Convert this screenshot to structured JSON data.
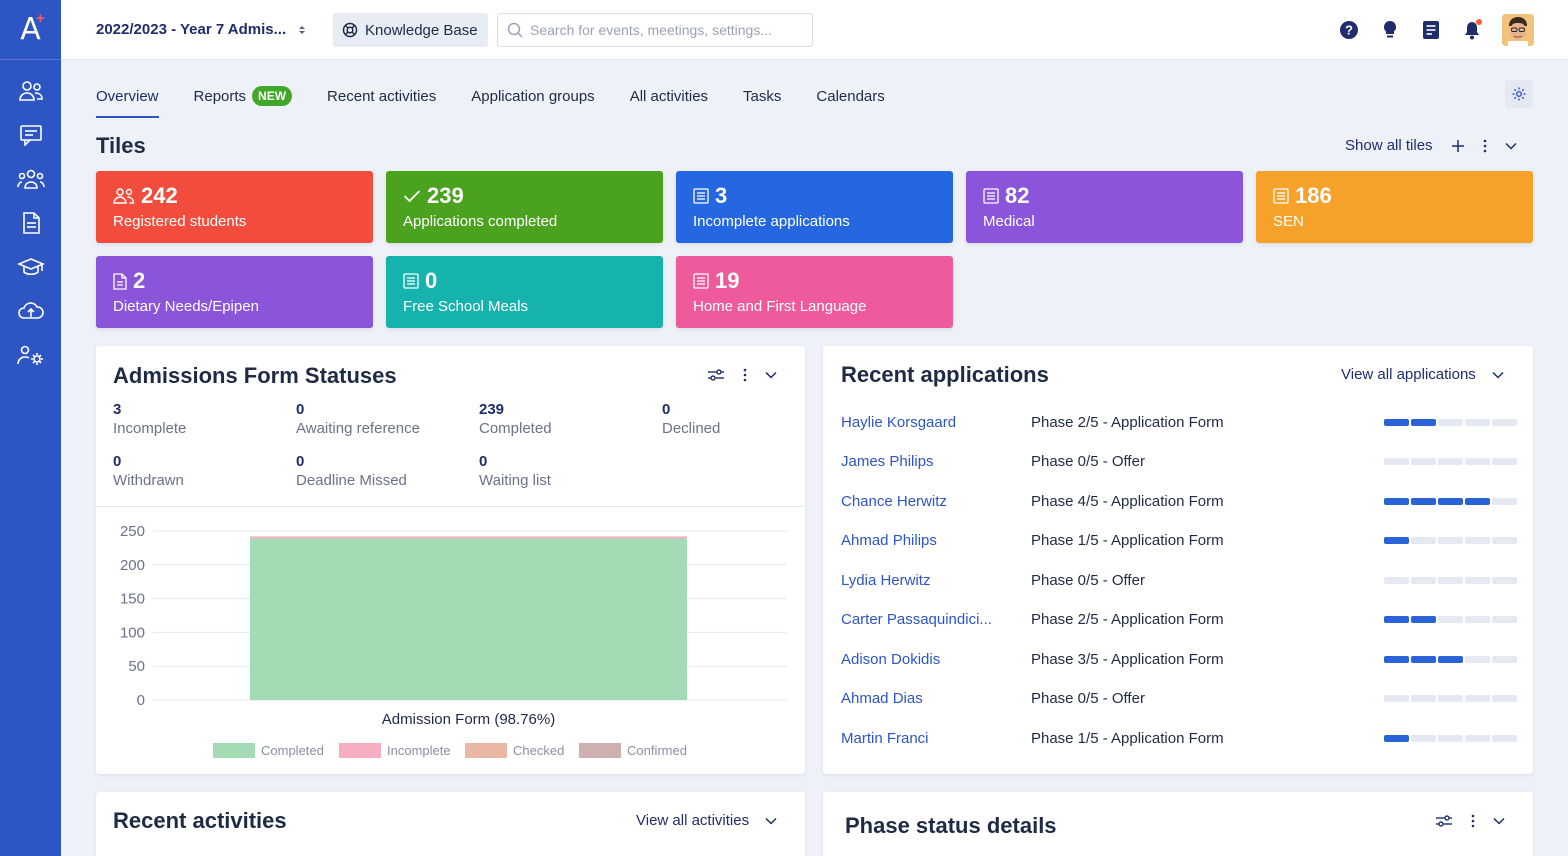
{
  "topbar": {
    "year_selector": "2022/2023 - Year 7 Admis...",
    "knowledge_base": "Knowledge Base",
    "search_placeholder": "Search for events, meetings, settings..."
  },
  "tabs": [
    {
      "label": "Overview",
      "active": true
    },
    {
      "label": "Reports",
      "badge": "NEW"
    },
    {
      "label": "Recent activities"
    },
    {
      "label": "Application groups"
    },
    {
      "label": "All activities"
    },
    {
      "label": "Tasks"
    },
    {
      "label": "Calendars"
    }
  ],
  "tiles": {
    "title": "Tiles",
    "show_all": "Show all tiles",
    "items": [
      {
        "number": "242",
        "label": "Registered students",
        "color": "#f24c3d",
        "icon": "users-icon"
      },
      {
        "number": "239",
        "label": "Applications completed",
        "color": "#4aa21f",
        "icon": "check-icon"
      },
      {
        "number": "3",
        "label": "Incomplete applications",
        "color": "#2467e0",
        "icon": "list-icon"
      },
      {
        "number": "82",
        "label": "Medical",
        "color": "#8a55db",
        "icon": "list-icon"
      },
      {
        "number": "186",
        "label": "SEN",
        "color": "#f5a12a",
        "icon": "list-icon"
      },
      {
        "number": "2",
        "label": "Dietary Needs/Epipen",
        "color": "#8a55db",
        "icon": "document-icon"
      },
      {
        "number": "0",
        "label": "Free School Meals",
        "color": "#16b2ae",
        "icon": "list-icon"
      },
      {
        "number": "19",
        "label": "Home and First Language",
        "color": "#ef5a9c",
        "icon": "list-icon"
      }
    ]
  },
  "admissions": {
    "title": "Admissions Form Statuses",
    "stats": [
      {
        "value": "3",
        "label": "Incomplete"
      },
      {
        "value": "0",
        "label": "Awaiting reference"
      },
      {
        "value": "239",
        "label": "Completed"
      },
      {
        "value": "0",
        "label": "Declined"
      },
      {
        "value": "0",
        "label": "Withdrawn"
      },
      {
        "value": "0",
        "label": "Deadline Missed"
      },
      {
        "value": "0",
        "label": "Waiting list"
      }
    ]
  },
  "chart_data": {
    "type": "bar",
    "stacked": true,
    "categories": [
      "Admission Form (98.76%)"
    ],
    "series": [
      {
        "name": "Completed",
        "values": [
          239
        ],
        "color": "#a3dbb4"
      },
      {
        "name": "Incomplete",
        "values": [
          3
        ],
        "color": "#f6aec0"
      },
      {
        "name": "Checked",
        "values": [
          0
        ],
        "color": "#e9b7a3"
      },
      {
        "name": "Confirmed",
        "values": [
          0
        ],
        "color": "#cfb0b0"
      }
    ],
    "ylim": [
      0,
      250
    ],
    "yticks": [
      "250",
      "200",
      "150",
      "100",
      "50",
      "0"
    ],
    "grid": true,
    "legend": "bottom"
  },
  "recent_applications": {
    "title": "Recent applications",
    "view_all": "View all applications",
    "rows": [
      {
        "name": "Haylie Korsgaard",
        "phase": "Phase 2/5 - Application Form",
        "progress": 2
      },
      {
        "name": "James Philips",
        "phase": "Phase 0/5 - Offer",
        "progress": 0
      },
      {
        "name": "Chance Herwitz",
        "phase": "Phase 4/5 - Application Form",
        "progress": 4
      },
      {
        "name": "Ahmad Philips",
        "phase": "Phase 1/5 - Application Form",
        "progress": 1
      },
      {
        "name": "Lydia Herwitz",
        "phase": "Phase 0/5 - Offer",
        "progress": 0
      },
      {
        "name": "Carter Passaquindici...",
        "phase": "Phase 2/5 - Application Form",
        "progress": 2
      },
      {
        "name": "Adison Dokidis",
        "phase": "Phase 3/5 - Application Form",
        "progress": 3
      },
      {
        "name": "Ahmad Dias",
        "phase": "Phase 0/5 - Offer",
        "progress": 0
      },
      {
        "name": "Martin Franci",
        "phase": "Phase 1/5 - Application Form",
        "progress": 1
      }
    ]
  },
  "recent_activities": {
    "title": "Recent activities",
    "view_all": "View all activities"
  },
  "phase_status": {
    "title": "Phase status details"
  }
}
